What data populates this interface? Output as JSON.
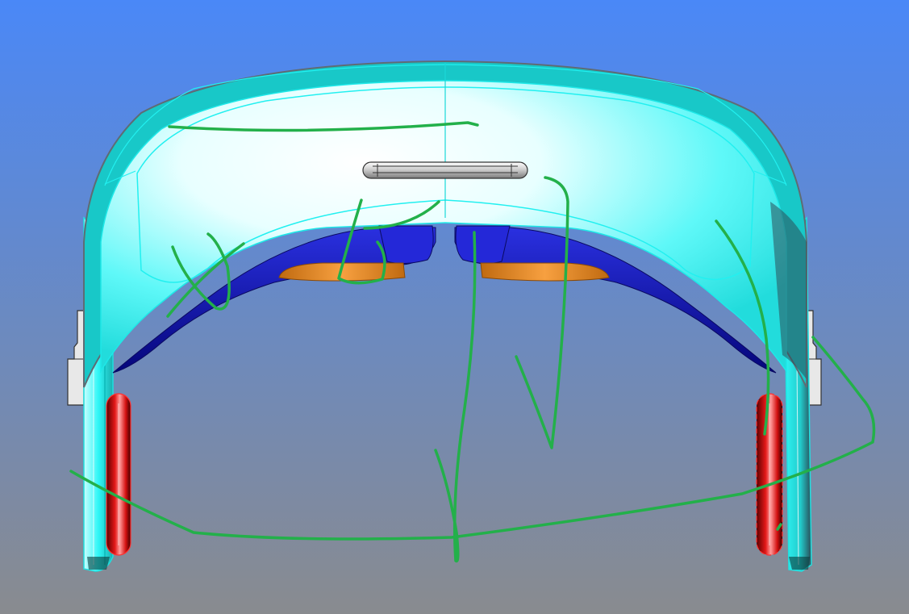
{
  "viewport": {
    "background_top": "#4a88f7",
    "background_bottom": "#898b8f"
  },
  "model": {
    "type": "vr-headset-front-view",
    "colors": {
      "shell_cyan": "#2ff6f6",
      "shell_highlight": "#ffffff",
      "shell_dark_band": "#12bfbf",
      "shell_outline": "#6a7a82",
      "face_cushion_blue": "#1a1ec8",
      "face_cushion_dark": "#05067a",
      "lens_orange": "#f7962f",
      "strap_pad_red": "#e41818",
      "side_bracket_grey": "#e8e8e8",
      "top_button_grey": "#d8d8d8"
    }
  },
  "annotation": {
    "type": "freehand-ink",
    "stroke_color": "#23b04a"
  }
}
